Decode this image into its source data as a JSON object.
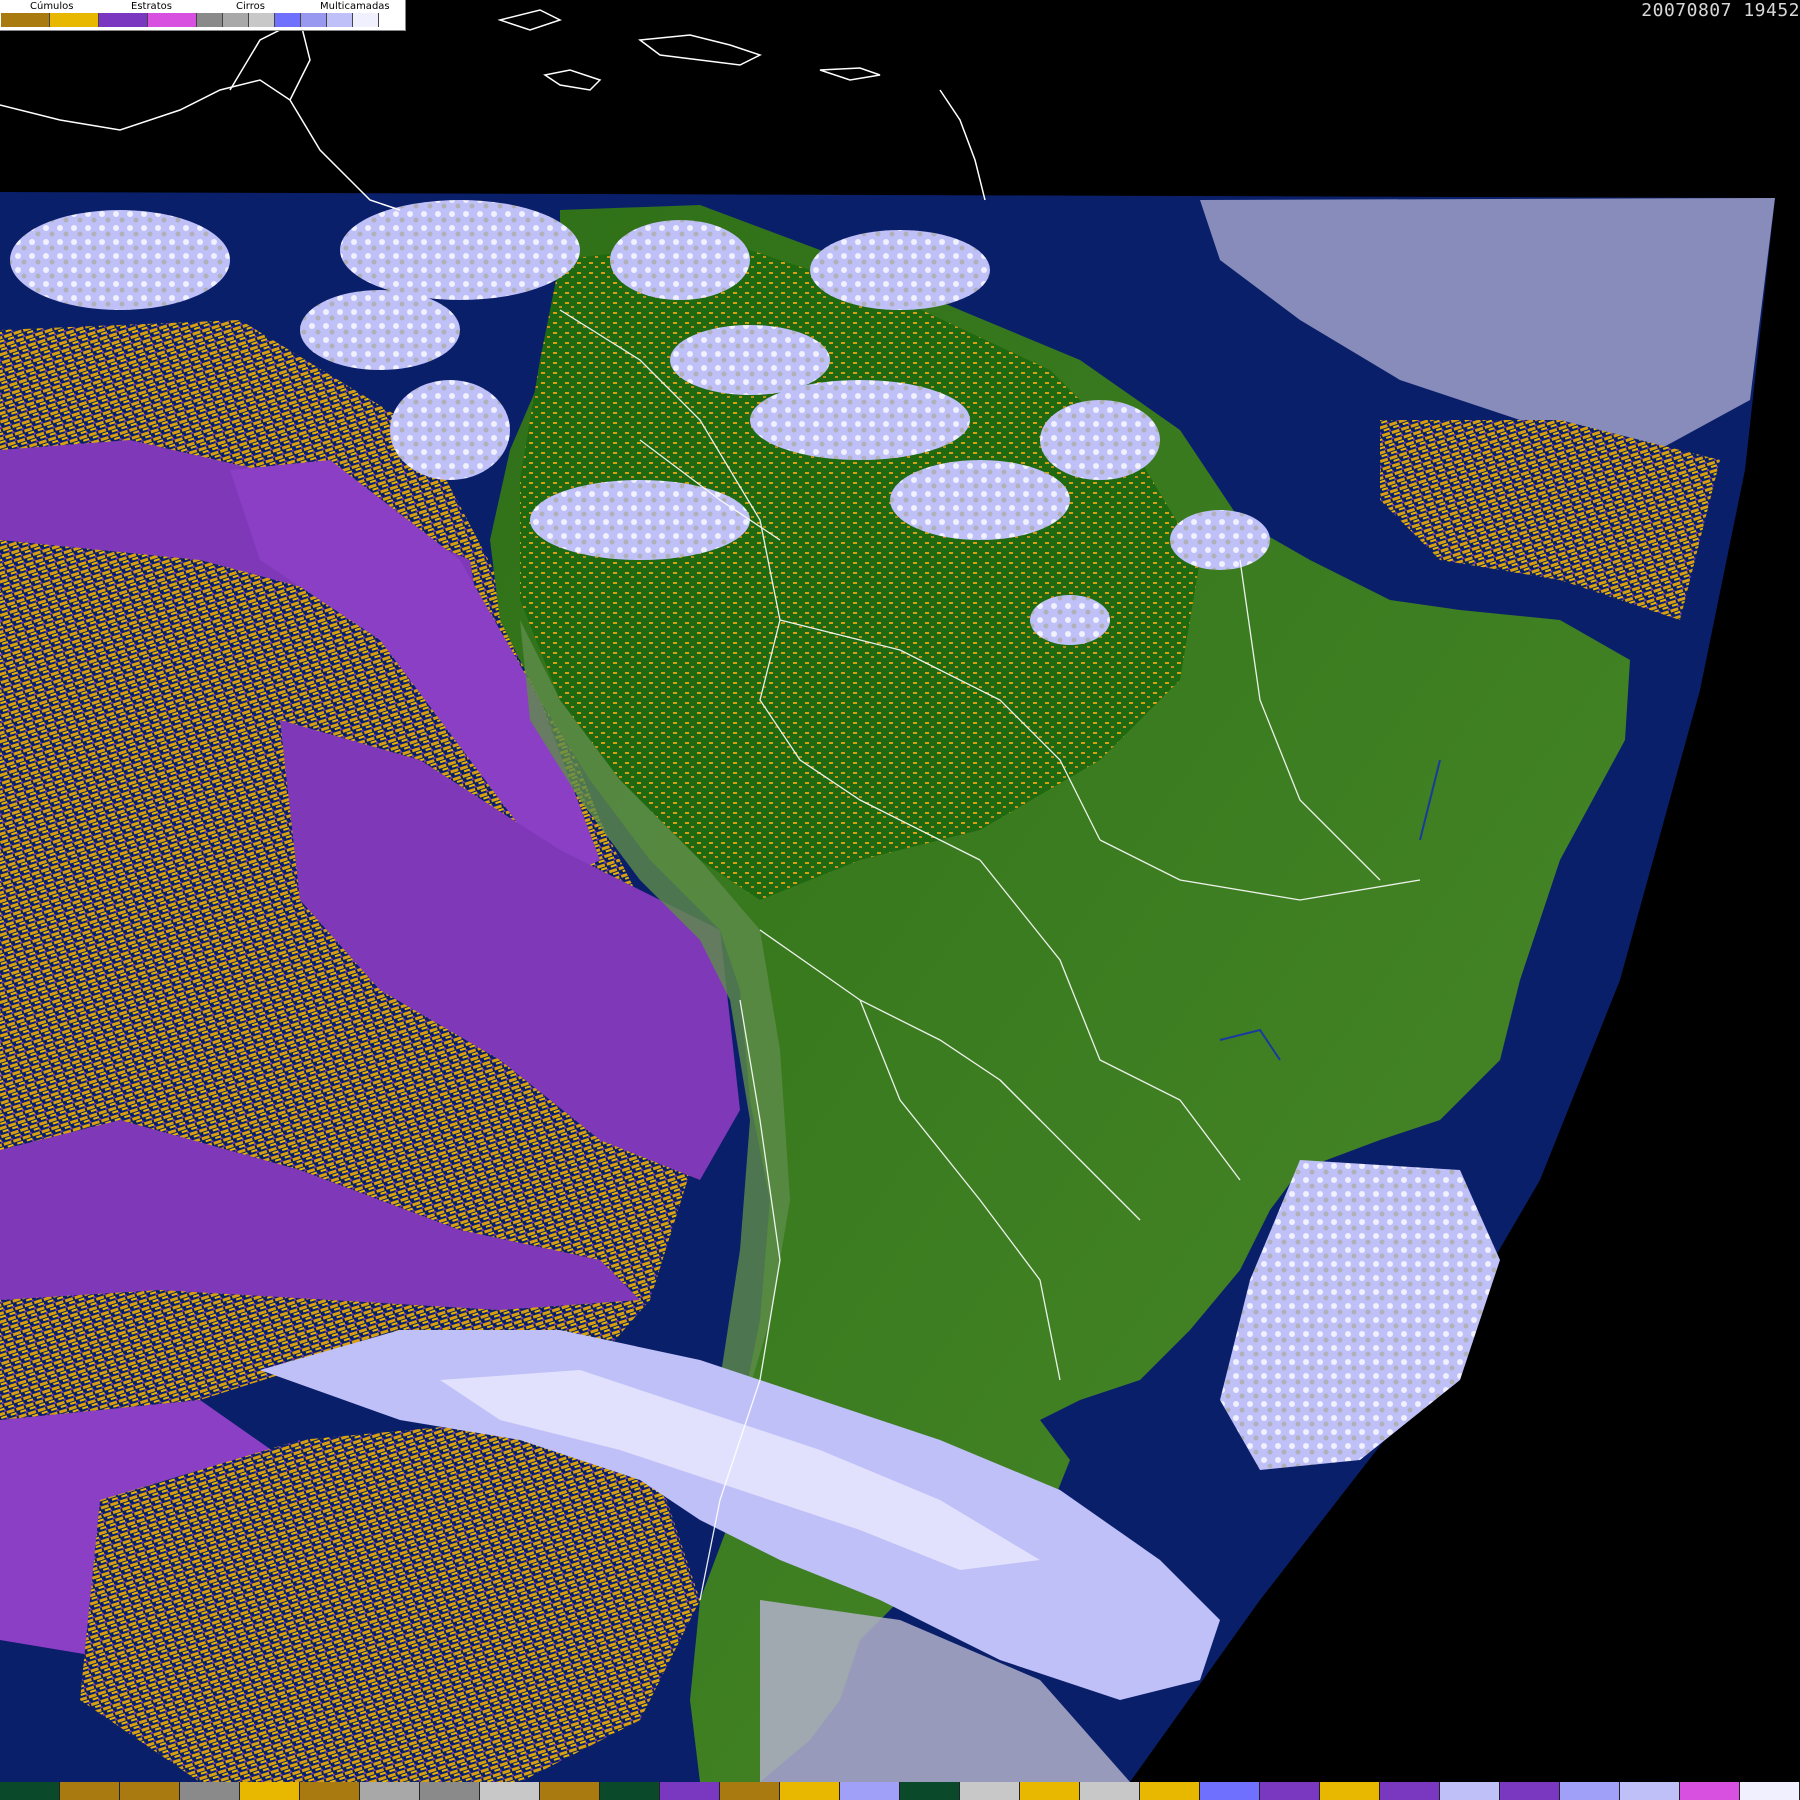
{
  "timestamp": "20070807 19452",
  "legend": {
    "groups": [
      {
        "label": "Cúmulos",
        "colors": [
          "#a87a10",
          "#e8b800"
        ]
      },
      {
        "label": "Estratos",
        "colors": [
          "#7a38c0",
          "#d850e0"
        ]
      },
      {
        "label": "Cirros",
        "colors": [
          "#8a8a8a",
          "#a8a8a8",
          "#c8c8c8"
        ]
      },
      {
        "label": "Multicamadas",
        "colors": [
          "#7070ff",
          "#9898f0",
          "#c0c0f8",
          "#f0f0ff"
        ]
      }
    ]
  },
  "colors": {
    "background": "#000000",
    "ocean": "#0a1f6a",
    "land": "#3f7a22",
    "forest": "#1f6a10",
    "cumulus": "#d8a010",
    "stratus": "#7f38b8",
    "cirrus": "#b0b0b8",
    "multilayer": "#c0c0f8",
    "border": "#ffffff"
  },
  "colorbar": [
    "#0a4a2a",
    "#a87a10",
    "#a87a10",
    "#8a8a8a",
    "#e8b800",
    "#a87a10",
    "#a8a8a8",
    "#8a8a8a",
    "#c8c8c8",
    "#a87a10",
    "#0a4a2a",
    "#7a38c0",
    "#a87a10",
    "#e8b800",
    "#a0a0f8",
    "#0a4a2a",
    "#c8c8c8",
    "#e8b800",
    "#c8c8c8",
    "#e8b800",
    "#7070ff",
    "#7a38c0",
    "#e8b800",
    "#7a38c0",
    "#c0c0f8",
    "#7a38c0",
    "#a0a0f8",
    "#c0c0f8",
    "#d850e0",
    "#f0f0ff"
  ]
}
